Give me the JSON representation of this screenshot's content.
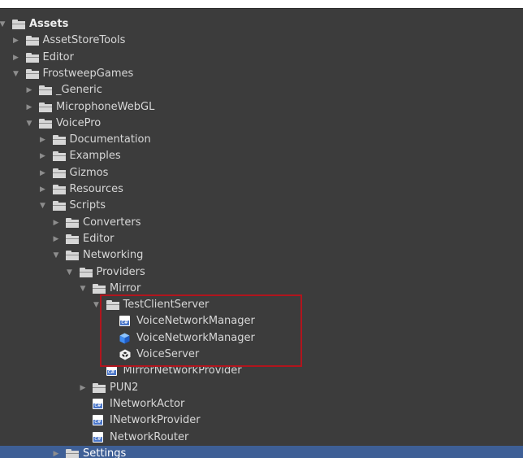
{
  "colors": {
    "panel_bg": "#3c3c3c",
    "selection_bg": "#3e5f96",
    "text": "#d7d7d7",
    "highlight_border": "#b1151d",
    "cs_icon_blue": "#4a76c9",
    "prefab_blue": "#3f8df3"
  },
  "tree": [
    {
      "label": "Assets",
      "icon": "folder-icon",
      "expanded": true,
      "depth": 0
    },
    {
      "label": "AssetStoreTools",
      "icon": "folder-icon",
      "expanded": false,
      "depth": 1
    },
    {
      "label": "Editor",
      "icon": "folder-icon",
      "expanded": false,
      "depth": 1
    },
    {
      "label": "FrostweepGames",
      "icon": "folder-icon",
      "expanded": true,
      "depth": 1
    },
    {
      "label": "_Generic",
      "icon": "folder-icon",
      "expanded": false,
      "depth": 2
    },
    {
      "label": "MicrophoneWebGL",
      "icon": "folder-icon",
      "expanded": false,
      "depth": 2
    },
    {
      "label": "VoicePro",
      "icon": "folder-icon",
      "expanded": true,
      "depth": 2
    },
    {
      "label": "Documentation",
      "icon": "folder-icon",
      "expanded": false,
      "depth": 3
    },
    {
      "label": "Examples",
      "icon": "folder-icon",
      "expanded": false,
      "depth": 3
    },
    {
      "label": "Gizmos",
      "icon": "folder-icon",
      "expanded": false,
      "depth": 3
    },
    {
      "label": "Resources",
      "icon": "folder-icon",
      "expanded": false,
      "depth": 3
    },
    {
      "label": "Scripts",
      "icon": "folder-icon",
      "expanded": true,
      "depth": 3
    },
    {
      "label": "Converters",
      "icon": "folder-icon",
      "expanded": false,
      "depth": 4
    },
    {
      "label": "Editor",
      "icon": "folder-icon",
      "expanded": false,
      "depth": 4
    },
    {
      "label": "Networking",
      "icon": "folder-icon",
      "expanded": true,
      "depth": 4
    },
    {
      "label": "Providers",
      "icon": "folder-icon",
      "expanded": true,
      "depth": 5
    },
    {
      "label": "Mirror",
      "icon": "folder-icon",
      "expanded": true,
      "depth": 6
    },
    {
      "label": "TestClientServer",
      "icon": "folder-icon",
      "expanded": true,
      "depth": 7
    },
    {
      "label": "VoiceNetworkManager",
      "icon": "cs-script-icon",
      "depth": 8
    },
    {
      "label": "VoiceNetworkManager",
      "icon": "prefab-icon",
      "depth": 8
    },
    {
      "label": "VoiceServer",
      "icon": "scene-icon",
      "depth": 8
    },
    {
      "label": "MirrorNetworkProvider",
      "icon": "cs-script-icon",
      "depth": 7
    },
    {
      "label": "PUN2",
      "icon": "folder-icon",
      "expanded": false,
      "depth": 6
    },
    {
      "label": "INetworkActor",
      "icon": "cs-script-icon",
      "depth": 6
    },
    {
      "label": "INetworkProvider",
      "icon": "cs-script-icon",
      "depth": 6
    },
    {
      "label": "NetworkRouter",
      "icon": "cs-script-icon",
      "depth": 6
    },
    {
      "label": "Settings",
      "icon": "folder-icon",
      "expanded": false,
      "depth": 4,
      "selected": true
    }
  ]
}
